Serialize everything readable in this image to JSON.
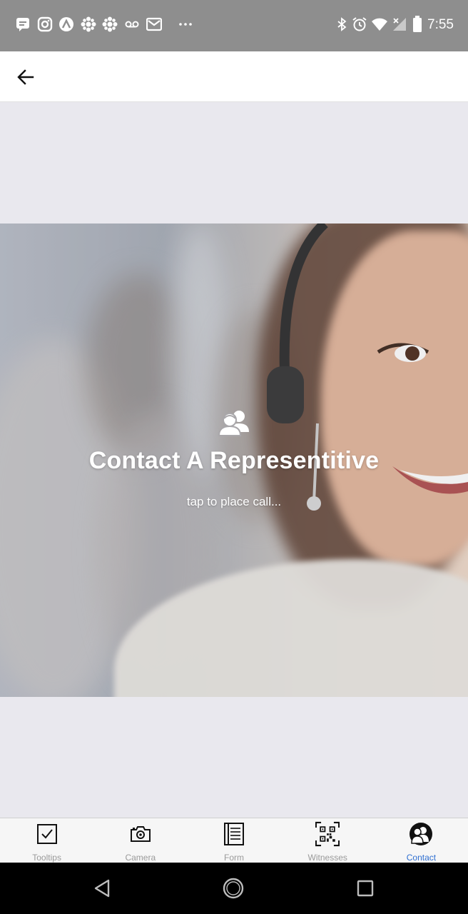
{
  "status_bar": {
    "time": "7:55",
    "left_icons": [
      "message-icon",
      "instagram-icon",
      "arc-icon",
      "cbc-icon",
      "cbc-icon",
      "voicemail-icon",
      "gmail-icon",
      "more-dots-icon"
    ],
    "right_icons": [
      "bluetooth-icon",
      "alarm-icon",
      "wifi-icon",
      "signal-icon",
      "battery-icon"
    ]
  },
  "app_bar": {
    "back_icon": "arrow-left-icon"
  },
  "hero": {
    "icon": "support-agents-icon",
    "title": "Contact A Representitive",
    "subtitle": "tap to place call..."
  },
  "bottom_nav": {
    "items": [
      {
        "label": "Tooltips",
        "icon": "checkbox-icon"
      },
      {
        "label": "Camera",
        "icon": "camera-icon"
      },
      {
        "label": "Form",
        "icon": "form-icon"
      },
      {
        "label": "Witnesses",
        "icon": "qr-code-icon"
      },
      {
        "label": "Contact",
        "icon": "contact-people-icon"
      }
    ],
    "active": "Contact",
    "active_color": "#2f6fd1",
    "inactive_color": "#9a9a9a"
  },
  "system_nav": {
    "buttons": [
      "back-triangle-icon",
      "home-circle-icon",
      "recents-square-icon"
    ]
  }
}
